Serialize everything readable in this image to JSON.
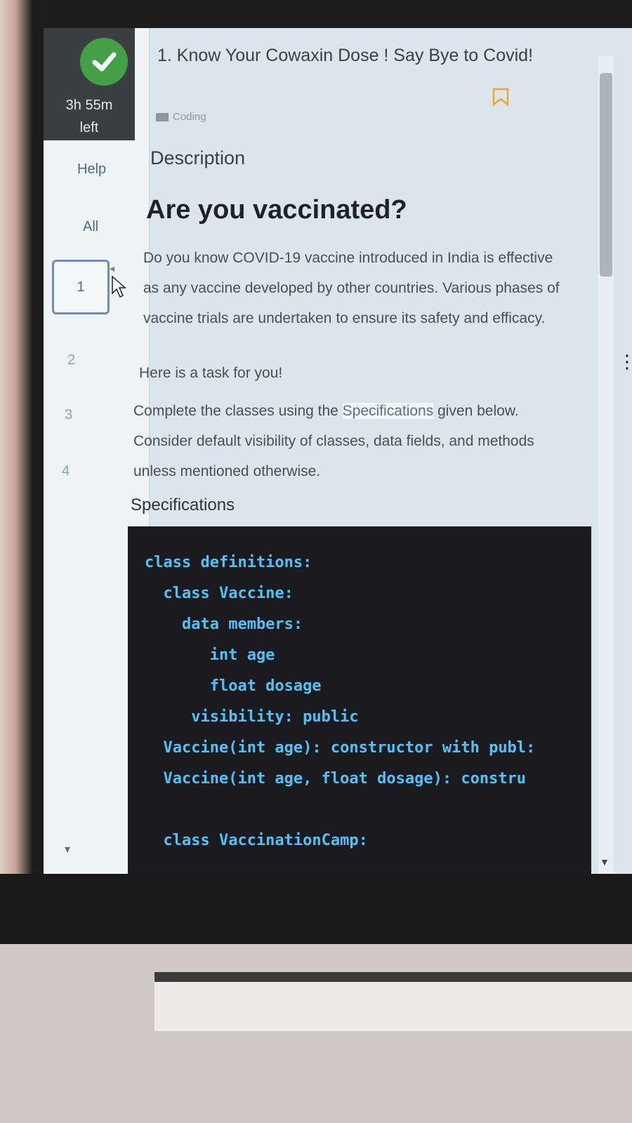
{
  "status": {
    "timer_line1": "3h 55m",
    "timer_line2": "left"
  },
  "rail": {
    "help_label": "Help",
    "all_label": "All",
    "questions": [
      "1",
      "2",
      "3",
      "4"
    ],
    "active_question": "1"
  },
  "question": {
    "title": "1. Know Your Cowaxin Dose ! Say Bye to Covid!",
    "tag": "Coding",
    "tab": "Description",
    "heading": "Are you vaccinated?",
    "para1": "Do you know COVID-19 vaccine introduced in India is effective as any vaccine developed by other countries. Various phases of vaccine trials are undertaken to ensure its safety and efficacy.",
    "para2": "Here is a task for you!",
    "para3_prefix": "Complete the classes using the ",
    "para3_highlight": "Specifications",
    "para3_suffix": " given below. Consider default visibility of classes, data fields, and methods unless mentioned otherwise.",
    "spec_label": "Specifications",
    "code": "class definitions:\n  class Vaccine:\n    data members:\n       int age\n       float dosage\n     visibility: public\n  Vaccine(int age): constructor with publ:\n  Vaccine(int age, float dosage): constru\n\n  class VaccinationCamp:"
  },
  "colors": {
    "accent": "#43a047",
    "code_text": "#4fc3f7",
    "code_bg": "#1b1b1f"
  }
}
